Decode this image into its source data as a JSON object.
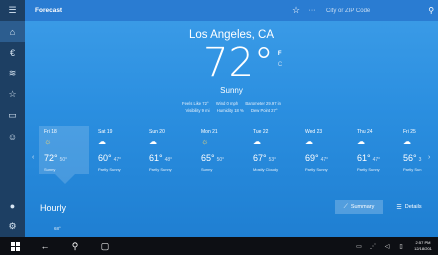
{
  "app": {
    "title": "Forecast"
  },
  "topbar": {
    "star_icon": "star-icon",
    "more_label": "···",
    "search_placeholder": "City or ZIP Code",
    "search_icon": "search-icon"
  },
  "sidebar": {
    "items": [
      {
        "name": "hamburger-menu",
        "glyph": "☰"
      },
      {
        "name": "home",
        "glyph": "⌂"
      },
      {
        "name": "news",
        "glyph": "€"
      },
      {
        "name": "maps",
        "glyph": "≋"
      },
      {
        "name": "favorites",
        "glyph": "☆"
      },
      {
        "name": "historical",
        "glyph": "▭"
      },
      {
        "name": "feedback",
        "glyph": "☺"
      }
    ],
    "bottom": [
      {
        "name": "account",
        "glyph": "●"
      },
      {
        "name": "settings",
        "glyph": "⚙"
      }
    ]
  },
  "current": {
    "city": "Los Angeles, CA",
    "temp": "72",
    "degree": "°",
    "unit_f": "F",
    "unit_c": "C",
    "condition": "Sunny",
    "feels_like": "Feels Like  72°",
    "wind": "Wind  0 mph",
    "barometer": "Barometer  29.97 in",
    "visibility": "Visibility  9 mi",
    "humidity": "Humidity  18 %",
    "dew_point": "Dew Point  27°"
  },
  "forecast": [
    {
      "day": "Fri 18",
      "icon": "sun",
      "hi": "72°",
      "lo": "50°",
      "cond": "Sunny",
      "selected": true
    },
    {
      "day": "Sat 19",
      "icon": "partly-sunny",
      "hi": "60°",
      "lo": "47°",
      "cond": "Partly Sunny"
    },
    {
      "day": "Sun 20",
      "icon": "partly-sunny",
      "hi": "61°",
      "lo": "48°",
      "cond": "Partly Sunny"
    },
    {
      "day": "Mon 21",
      "icon": "sun",
      "hi": "65°",
      "lo": "50°",
      "cond": "Sunny"
    },
    {
      "day": "Tue 22",
      "icon": "partly-sunny",
      "hi": "67°",
      "lo": "53°",
      "cond": "Mostly Cloudy"
    },
    {
      "day": "Wed 23",
      "icon": "partly-sunny",
      "hi": "69°",
      "lo": "47°",
      "cond": "Partly Sunny"
    },
    {
      "day": "Thu 24",
      "icon": "partly-sunny",
      "hi": "61°",
      "lo": "47°",
      "cond": "Partly Sunny"
    },
    {
      "day": "Fri 25",
      "icon": "partly-sunny",
      "hi": "56°",
      "lo": "3",
      "cond": "Partly Sun"
    }
  ],
  "hourly": {
    "title": "Hourly",
    "summary_label": "Summary",
    "details_label": "Details",
    "first_temp": "68°"
  },
  "taskbar": {
    "time": "2:57 PM",
    "date": "12/18/201"
  }
}
